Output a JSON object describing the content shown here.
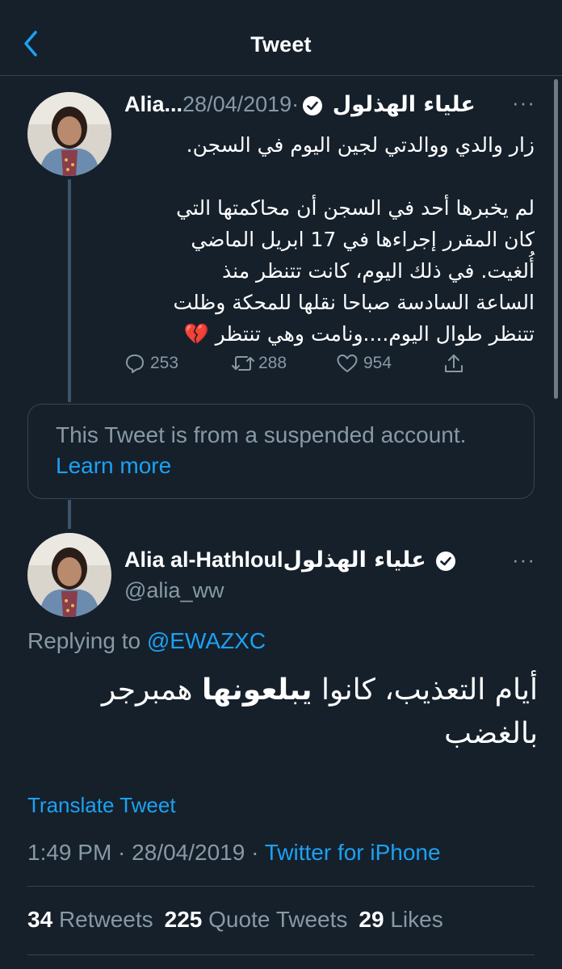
{
  "header": {
    "title": "Tweet",
    "back_icon": "chevron-left-icon"
  },
  "parent_tweet": {
    "name_arabic": "علياء الهذلول",
    "name_latin": "Alia...",
    "verified": true,
    "date": "28/04/2019",
    "more_icon": "more-dots-icon",
    "text_lines": [
      "زار والدي ووالدتي لجين اليوم في السجن.",
      "",
      "لم يخبرها أحد في السجن أن محاكمتها التي",
      "كان المقرر إجراءها في 17 ابريل الماضي",
      "أُلغيت. في ذلك اليوم، كانت تتنظر منذ",
      "الساعة السادسة صباحا نقلها للمحكة وظلت",
      "تتنظر طوال اليوم....ونامت وهي تنتظر 💔"
    ],
    "actions": {
      "reply_count": "253",
      "retweet_count": "288",
      "like_count": "954"
    }
  },
  "suspended_notice": {
    "text": "This Tweet is from a suspended account.",
    "link": "Learn more"
  },
  "main_tweet": {
    "name_latin": "Alia al-Hathloul",
    "name_arabic": "علياء الهذلول",
    "verified": true,
    "handle": "@alia_ww",
    "replying_prefix": "Replying to",
    "replying_to": "@EWAZXC",
    "text_line1_before": "أيام التعذيب، كانوا ",
    "text_line1_bold": "يبلعونها",
    "text_line1_after": " همبرجر",
    "text_line2": "بالغضب",
    "translate_label": "Translate Tweet",
    "time": "1:49 PM",
    "date": "28/04/2019",
    "client": "Twitter for iPhone",
    "stats": {
      "retweets_count": "34",
      "retweets_label": "Retweets",
      "quotes_count": "225",
      "quotes_label": "Quote Tweets",
      "likes_count": "29",
      "likes_label": "Likes"
    }
  },
  "colors": {
    "background": "#15202b",
    "accent": "#1da1f2",
    "secondary_text": "#8899a6",
    "divider": "#38444d"
  }
}
